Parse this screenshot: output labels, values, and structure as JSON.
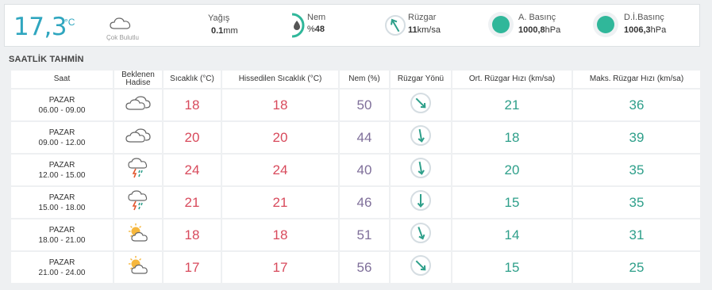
{
  "current": {
    "temperature": "17,3",
    "unit": "°C",
    "condition": "Çok Bulutlu",
    "condition_icon": "cloud-icon",
    "rain_label": "Yağış",
    "rain_value": "0.1",
    "rain_unit": "mm",
    "humidity_label": "Nem",
    "humidity_prefix": "%",
    "humidity_value": "48",
    "humidity_percent": 48,
    "wind_label": "Rüzgar",
    "wind_value": "11",
    "wind_unit": "km/sa",
    "pressure_label": "A. Basınç",
    "pressure_value": "1000,8",
    "pressure_unit": "hPa",
    "sea_pressure_label": "D.İ.Basınç",
    "sea_pressure_value": "1006,3",
    "sea_pressure_unit": "hPa"
  },
  "hourly": {
    "title": "SAATLİK TAHMİN",
    "headers": [
      "Saat",
      "Beklenen Hadise",
      "Sıcaklık (°C)",
      "Hissedilen Sıcaklık (°C)",
      "Nem (%)",
      "Rüzgar Yönü",
      "Ort. Rüzgar Hızı (km/sa)",
      "Maks. Rüzgar Hızı (km/sa)"
    ],
    "rows": [
      {
        "day": "PAZAR",
        "time": "06.00 - 09.00",
        "icon": "cloud-icon",
        "temp": "18",
        "feels": "18",
        "humidity": "50",
        "wind_dir_deg": 135,
        "avg_wind": "21",
        "max_wind": "36"
      },
      {
        "day": "PAZAR",
        "time": "09.00 - 12.00",
        "icon": "cloud-icon",
        "temp": "20",
        "feels": "20",
        "humidity": "44",
        "wind_dir_deg": 170,
        "avg_wind": "18",
        "max_wind": "39"
      },
      {
        "day": "PAZAR",
        "time": "12.00 - 15.00",
        "icon": "thunderstorm-icon",
        "temp": "24",
        "feels": "24",
        "humidity": "40",
        "wind_dir_deg": 170,
        "avg_wind": "20",
        "max_wind": "35"
      },
      {
        "day": "PAZAR",
        "time": "15.00 - 18.00",
        "icon": "thunderstorm-icon",
        "temp": "21",
        "feels": "21",
        "humidity": "46",
        "wind_dir_deg": 180,
        "avg_wind": "15",
        "max_wind": "35"
      },
      {
        "day": "PAZAR",
        "time": "18.00 - 21.00",
        "icon": "partly-cloudy-icon",
        "temp": "18",
        "feels": "18",
        "humidity": "51",
        "wind_dir_deg": 160,
        "avg_wind": "14",
        "max_wind": "31"
      },
      {
        "day": "PAZAR",
        "time": "21.00 - 24.00",
        "icon": "partly-cloudy-icon",
        "temp": "17",
        "feels": "17",
        "humidity": "56",
        "wind_dir_deg": 135,
        "avg_wind": "15",
        "max_wind": "25"
      }
    ]
  },
  "colors": {
    "accent": "#2fa6bf",
    "temp": "#d84a5c",
    "humidity": "#7f6f9a",
    "wind": "#2e9f8a",
    "pressure": "#30b79a"
  }
}
